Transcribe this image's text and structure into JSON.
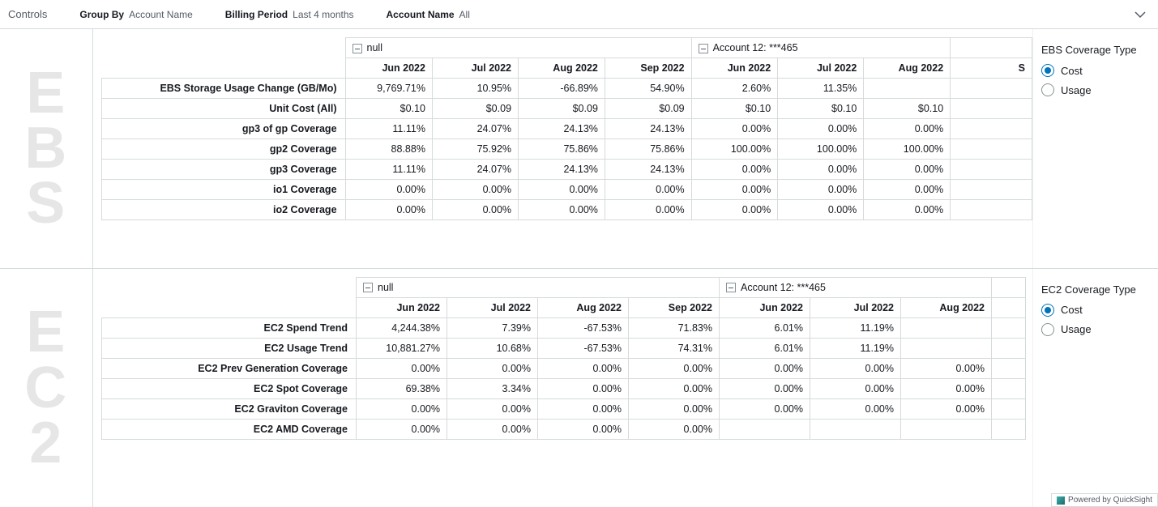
{
  "controls": {
    "title": "Controls",
    "groups": [
      {
        "label": "Group By",
        "value": "Account Name"
      },
      {
        "label": "Billing Period",
        "value": "Last 4 months"
      },
      {
        "label": "Account Name",
        "value": "All"
      }
    ]
  },
  "rail": {
    "ebs": "E\nB\nS",
    "ec2": "E\nC\n2"
  },
  "ebs": {
    "right": {
      "title": "EBS Coverage Type",
      "opt1": "Cost",
      "opt2": "Usage"
    },
    "groups": [
      {
        "label": "null",
        "months": [
          "Jun 2022",
          "Jul 2022",
          "Aug 2022",
          "Sep 2022"
        ]
      },
      {
        "label": "Account 12: ***465",
        "months": [
          "Jun 2022",
          "Jul 2022",
          "Aug 2022"
        ]
      }
    ],
    "extraMonth": "S",
    "rows": [
      {
        "label": "EBS Storage Usage Change (GB/Mo)",
        "vals": [
          "9,769.71%",
          "10.95%",
          "-66.89%",
          "54.90%",
          "2.60%",
          "11.35%"
        ]
      },
      {
        "label": "Unit Cost (All)",
        "vals": [
          "$0.10",
          "$0.09",
          "$0.09",
          "$0.09",
          "$0.10",
          "$0.10",
          "$0.10"
        ]
      },
      {
        "label": "gp3 of gp Coverage",
        "vals": [
          "11.11%",
          "24.07%",
          "24.13%",
          "24.13%",
          "0.00%",
          "0.00%",
          "0.00%"
        ]
      },
      {
        "label": "gp2 Coverage",
        "vals": [
          "88.88%",
          "75.92%",
          "75.86%",
          "75.86%",
          "100.00%",
          "100.00%",
          "100.00%"
        ]
      },
      {
        "label": "gp3 Coverage",
        "vals": [
          "11.11%",
          "24.07%",
          "24.13%",
          "24.13%",
          "0.00%",
          "0.00%",
          "0.00%"
        ]
      },
      {
        "label": "io1 Coverage",
        "vals": [
          "0.00%",
          "0.00%",
          "0.00%",
          "0.00%",
          "0.00%",
          "0.00%",
          "0.00%"
        ]
      },
      {
        "label": "io2 Coverage",
        "vals": [
          "0.00%",
          "0.00%",
          "0.00%",
          "0.00%",
          "0.00%",
          "0.00%",
          "0.00%"
        ]
      }
    ]
  },
  "ec2": {
    "right": {
      "title": "EC2 Coverage Type",
      "opt1": "Cost",
      "opt2": "Usage"
    },
    "groups": [
      {
        "label": "null",
        "months": [
          "Jun 2022",
          "Jul 2022",
          "Aug 2022",
          "Sep 2022"
        ]
      },
      {
        "label": "Account 12: ***465",
        "months": [
          "Jun 2022",
          "Jul 2022",
          "Aug 2022"
        ]
      }
    ],
    "rows": [
      {
        "label": "EC2 Spend Trend",
        "vals": [
          "4,244.38%",
          "7.39%",
          "-67.53%",
          "71.83%",
          "6.01%",
          "11.19%"
        ]
      },
      {
        "label": "EC2 Usage Trend",
        "vals": [
          "10,881.27%",
          "10.68%",
          "-67.53%",
          "74.31%",
          "6.01%",
          "11.19%"
        ]
      },
      {
        "label": "EC2 Prev Generation Coverage",
        "vals": [
          "0.00%",
          "0.00%",
          "0.00%",
          "0.00%",
          "0.00%",
          "0.00%",
          "0.00%"
        ]
      },
      {
        "label": "EC2 Spot Coverage",
        "vals": [
          "69.38%",
          "3.34%",
          "0.00%",
          "0.00%",
          "0.00%",
          "0.00%",
          "0.00%"
        ]
      },
      {
        "label": "EC2 Graviton Coverage",
        "vals": [
          "0.00%",
          "0.00%",
          "0.00%",
          "0.00%",
          "0.00%",
          "0.00%",
          "0.00%"
        ]
      },
      {
        "label": "EC2 AMD Coverage",
        "vals": [
          "0.00%",
          "0.00%",
          "0.00%",
          "0.00%"
        ]
      }
    ]
  },
  "footer": {
    "powered": "Powered by QuickSight"
  }
}
